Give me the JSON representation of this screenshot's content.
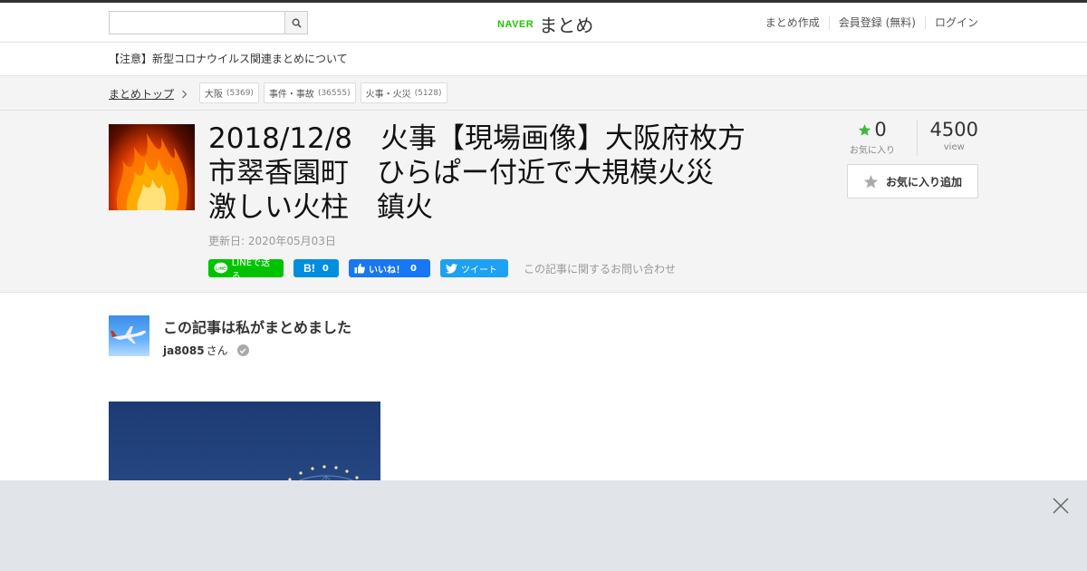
{
  "header": {
    "search": {
      "value": "",
      "placeholder": ""
    },
    "logo": {
      "brand": "NAVER",
      "name": "まとめ"
    },
    "links": [
      "まとめ作成",
      "会員登録 (無料)",
      "ログイン"
    ]
  },
  "notice": "【注意】新型コロナウイルス関連まとめについて",
  "breadcrumb": {
    "top": "まとめトップ",
    "tags": [
      {
        "name": "大阪",
        "count": "(5369)"
      },
      {
        "name": "事件・事故",
        "count": "(36555)"
      },
      {
        "name": "火事・火災",
        "count": "(5128)"
      }
    ]
  },
  "article": {
    "title_lines": [
      "2018/12/8　火事【現場画像】大阪府枚方",
      "市翠香園町　ひらぱー付近で大規模火災",
      "激しい火柱　鎮火"
    ],
    "updated": "更新日: 2020年05月03日",
    "share": {
      "line": "LINEで送る",
      "hatena_count": "0",
      "fb": "いいね！",
      "fb_count": "0",
      "tweet": "ツイート",
      "contact": "この記事に関するお問い合わせ"
    },
    "stats": {
      "favorites": "0",
      "favorites_label": "お気に入り",
      "views": "4500",
      "views_label": "view"
    },
    "fav_button": "お気に入り追加"
  },
  "author": {
    "heading": "この記事は私がまとめました",
    "name": "ja8085",
    "suffix": "さん"
  },
  "colors": {
    "accent_green": "#1ec800",
    "line_green": "#00c300",
    "hatena_blue": "#008fde",
    "facebook_blue": "#1877f2",
    "twitter_blue": "#1da1f2",
    "star_green": "#3cb93c"
  }
}
